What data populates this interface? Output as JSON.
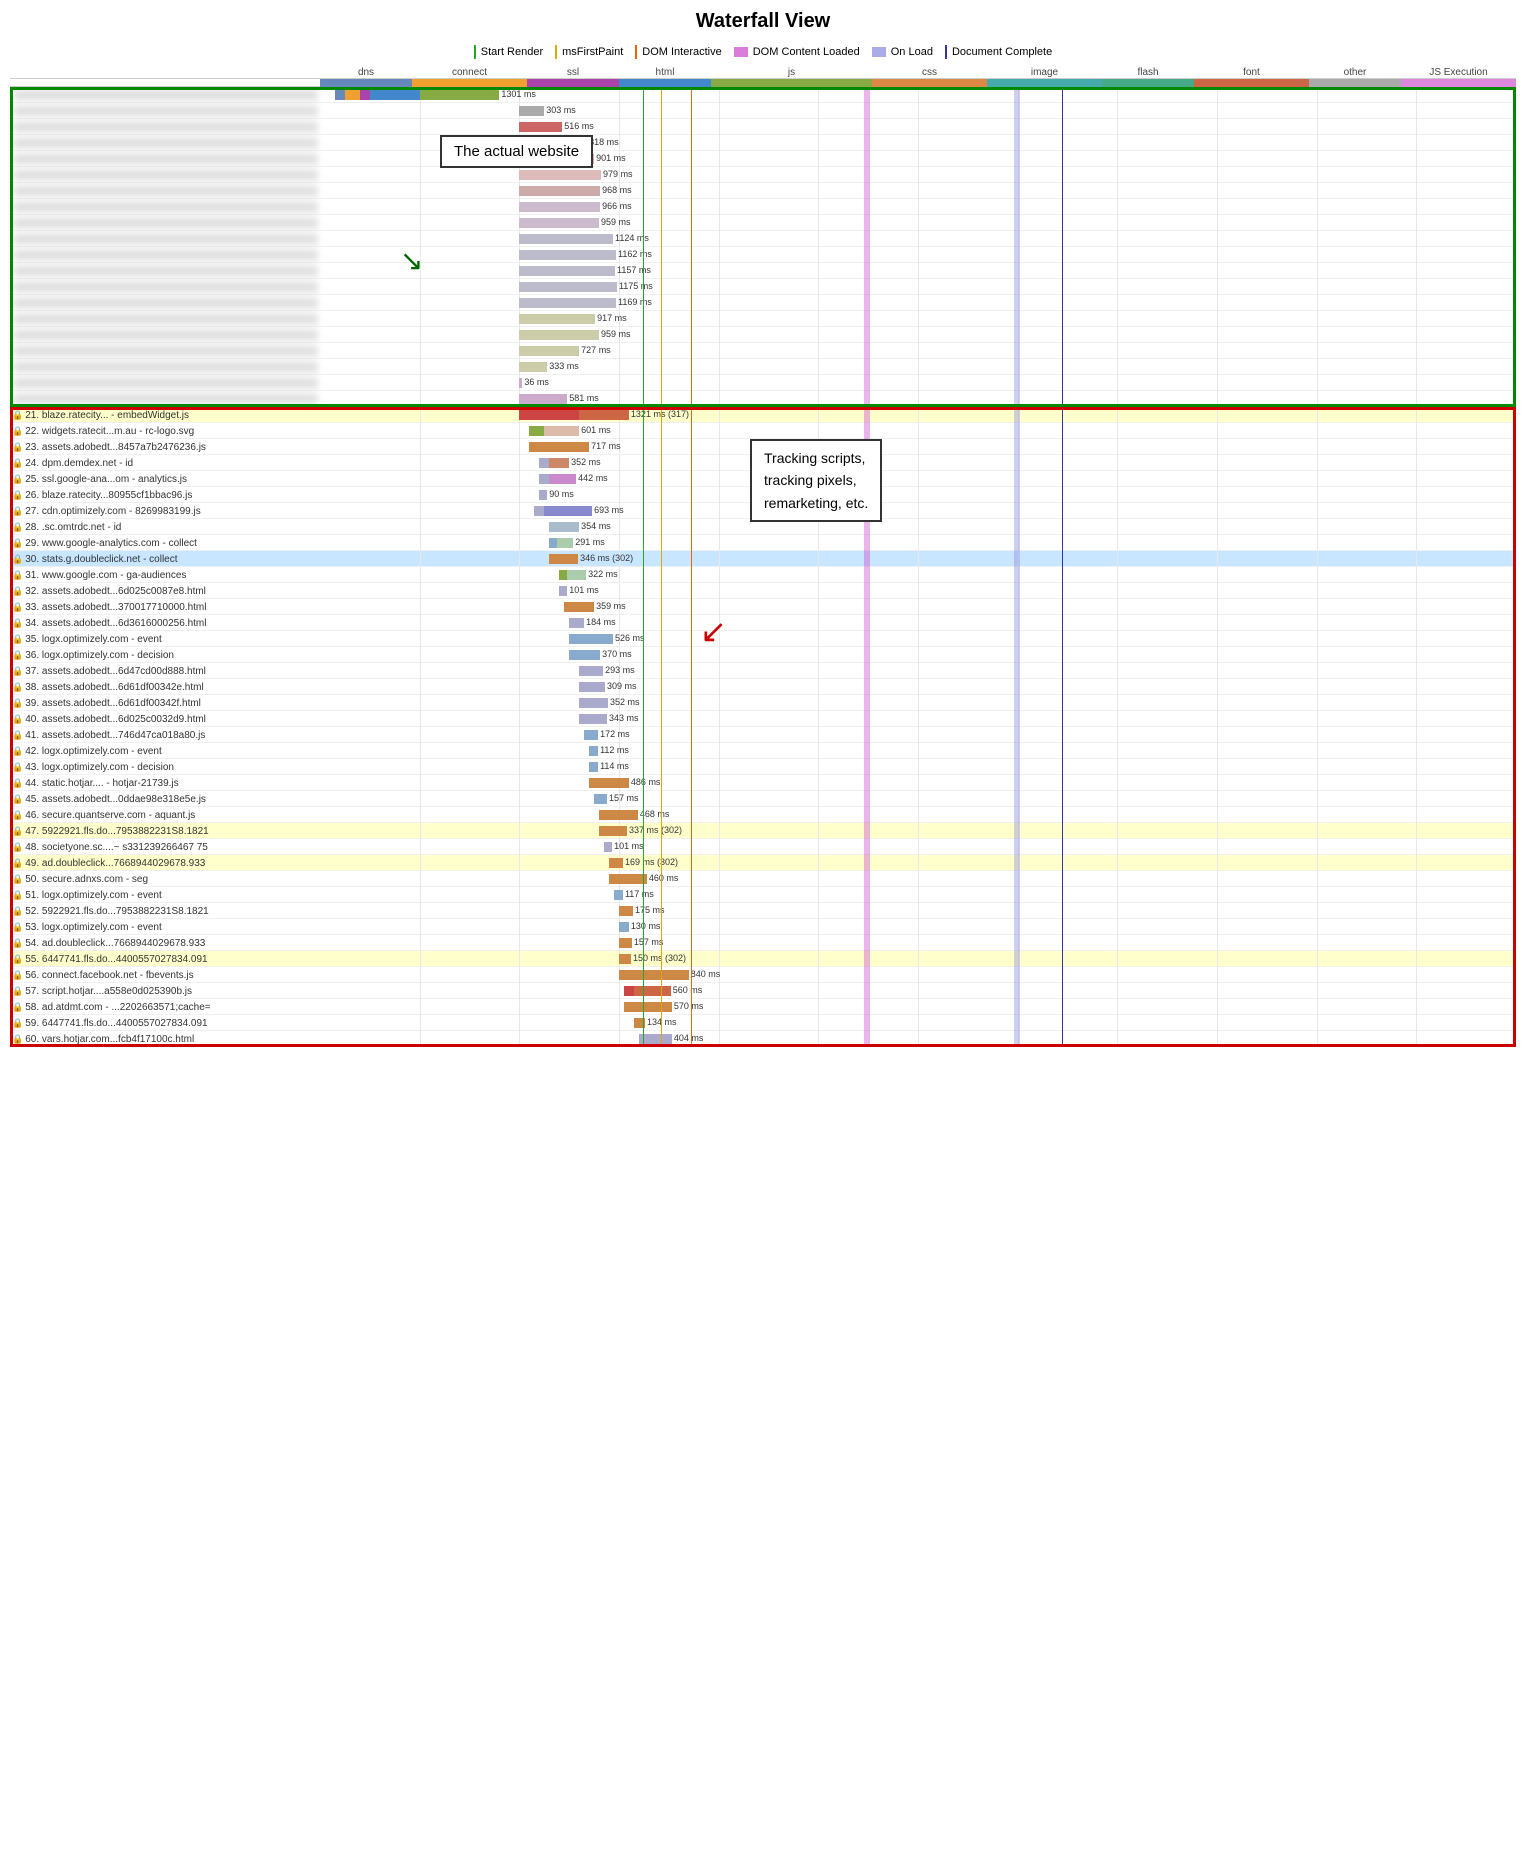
{
  "title": "Waterfall View",
  "legend": {
    "items": [
      {
        "label": "Start Render",
        "color": "#22aa22",
        "type": "line"
      },
      {
        "label": "msFirstPaint",
        "color": "#ddaa00",
        "type": "line"
      },
      {
        "label": "DOM Interactive",
        "color": "#ee6600",
        "type": "line"
      },
      {
        "label": "DOM Content Loaded",
        "color": "#cc44cc",
        "type": "bar"
      },
      {
        "label": "On Load",
        "color": "#8888dd",
        "type": "bar"
      },
      {
        "label": "Document Complete",
        "color": "#3333aa",
        "type": "line"
      }
    ]
  },
  "type_headers": [
    {
      "label": "dns",
      "color": "#6688bb",
      "width": 4
    },
    {
      "label": "connect",
      "color": "#f0a030",
      "width": 6
    },
    {
      "label": "ssl",
      "color": "#aa44aa",
      "width": 4
    },
    {
      "label": "html",
      "color": "#4488cc",
      "width": 4
    },
    {
      "label": "js",
      "color": "#88aa44",
      "width": 8
    },
    {
      "label": "css",
      "color": "#dd8844",
      "width": 6
    },
    {
      "label": "image",
      "color": "#44aaaa",
      "width": 6
    },
    {
      "label": "flash",
      "color": "#44aa88",
      "width": 5
    },
    {
      "label": "font",
      "color": "#cc6644",
      "width": 5
    },
    {
      "label": "other",
      "color": "#aaaaaa",
      "width": 4
    },
    {
      "label": "JS Execution",
      "color": "#dd88dd",
      "width": 5
    }
  ],
  "rows": [
    {
      "id": 1,
      "url": "(blurred)",
      "blurred": true,
      "start": 0,
      "dns": 0.5,
      "connect": 0.3,
      "ssl": 0.2,
      "ttfb": 0.8,
      "download": 0.3,
      "color": "#88aacc",
      "label": "1301 ms",
      "rowtype": "normal"
    },
    {
      "id": 2,
      "url": "(blurred)",
      "blurred": true,
      "start": 2.0,
      "ttfb": 0.3,
      "download": 0.1,
      "color": "#cccccc",
      "label": "303 ms",
      "rowtype": "normal"
    },
    {
      "id": 3,
      "url": "(blurred)",
      "blurred": true,
      "start": 2.0,
      "ttfb": 0.3,
      "download": 0.2,
      "color": "#cc6666",
      "label": "516 ms",
      "rowtype": "normal"
    },
    {
      "id": 4,
      "url": "(blurred)",
      "blurred": true,
      "start": 2.0,
      "ttfb": 0.5,
      "download": 0.3,
      "color": "#cc8888",
      "label": "818 ms",
      "rowtype": "normal"
    },
    {
      "id": 5,
      "url": "(blurred)",
      "blurred": true,
      "start": 2.0,
      "ttfb": 0.5,
      "download": 0.4,
      "color": "#ddaaaa",
      "label": "901 ms",
      "rowtype": "normal"
    },
    {
      "id": 6,
      "url": "(blurred)",
      "blurred": true,
      "start": 2.0,
      "color": "#ddbbbb",
      "label": "979 ms",
      "rowtype": "normal"
    },
    {
      "id": 7,
      "url": "(blurred)",
      "blurred": true,
      "start": 2.0,
      "color": "#ccaaaa",
      "label": "968 ms",
      "rowtype": "normal"
    },
    {
      "id": 8,
      "url": "(blurred)",
      "blurred": true,
      "start": 2.0,
      "color": "#ccbbcc",
      "label": "966 ms",
      "rowtype": "normal"
    },
    {
      "id": 9,
      "url": "(blurred)",
      "blurred": true,
      "start": 2.0,
      "color": "#ccbbcc",
      "label": "959 ms",
      "rowtype": "normal"
    },
    {
      "id": 10,
      "url": "(blurred)",
      "blurred": true,
      "start": 2.0,
      "color": "#bbbbcc",
      "label": "1124 ms",
      "rowtype": "normal"
    },
    {
      "id": 11,
      "url": "(blurred)",
      "blurred": true,
      "start": 2.0,
      "color": "#bbbbcc",
      "label": "1162 ms",
      "rowtype": "normal"
    },
    {
      "id": 12,
      "url": "(blurred)",
      "blurred": true,
      "start": 2.0,
      "color": "#bbbbcc",
      "label": "1157 ms",
      "rowtype": "normal"
    },
    {
      "id": 13,
      "url": "(blurred)",
      "blurred": true,
      "start": 2.0,
      "color": "#bbbbcc",
      "label": "1175 ms",
      "rowtype": "normal"
    },
    {
      "id": 14,
      "url": "(blurred)",
      "blurred": true,
      "start": 2.0,
      "color": "#bbbbcc",
      "label": "1169 ms",
      "rowtype": "normal"
    },
    {
      "id": 15,
      "url": "(blurred)",
      "blurred": true,
      "start": 2.0,
      "color": "#ccccaa",
      "label": "917 ms",
      "rowtype": "normal"
    },
    {
      "id": 16,
      "url": "(blurred)",
      "blurred": true,
      "start": 2.0,
      "color": "#ccccaa",
      "label": "959 ms",
      "rowtype": "normal"
    },
    {
      "id": 17,
      "url": "(blurred)",
      "blurred": true,
      "start": 2.0,
      "color": "#ccccaa",
      "label": "727 ms",
      "rowtype": "normal"
    },
    {
      "id": 18,
      "url": "(blurred)",
      "blurred": true,
      "start": 2.0,
      "color": "#ccccaa",
      "label": "333 ms",
      "rowtype": "normal"
    },
    {
      "id": 19,
      "url": "(blurred)",
      "blurred": true,
      "start": 2.0,
      "color": "#ccaacc",
      "label": "36 ms",
      "rowtype": "normal"
    },
    {
      "id": 20,
      "url": "(blurred)",
      "blurred": true,
      "start": 2.0,
      "color": "#ccaacc",
      "label": "581 ms",
      "rowtype": "normal"
    },
    {
      "id": 21,
      "url": "21. blaze.ratecity... - embedWidget.js",
      "blurred": false,
      "start": 2.0,
      "color": "#cc4444",
      "label": "1321 ms (317)",
      "rowtype": "yellow"
    },
    {
      "id": 22,
      "url": "22. widgets.ratecit...m.au - rc-logo.svg",
      "blurred": false,
      "start": 2.1,
      "color": "#88aa44",
      "label": "601 ms",
      "rowtype": "normal"
    },
    {
      "id": 23,
      "url": "23. assets.adobedt...8457a7b2476236.js",
      "blurred": false,
      "start": 2.1,
      "color": "#cc8844",
      "label": "717 ms",
      "rowtype": "normal"
    },
    {
      "id": 24,
      "url": "24. dpm.demdex.net - id",
      "blurred": false,
      "start": 2.2,
      "color": "#ccaaaa",
      "label": "352 ms",
      "rowtype": "normal"
    },
    {
      "id": 25,
      "url": "25. ssl.google-ana...om - analytics.js",
      "blurred": false,
      "start": 2.2,
      "color": "#ccaacc",
      "label": "442 ms",
      "rowtype": "normal"
    },
    {
      "id": 26,
      "url": "26. blaze.ratecity...80955cf1bbac96.js",
      "blurred": false,
      "start": 2.2,
      "color": "#aaaacc",
      "label": "90 ms",
      "rowtype": "normal"
    },
    {
      "id": 27,
      "url": "27. cdn.optimizely.com - 8269983199.js",
      "blurred": false,
      "start": 2.2,
      "color": "#8888cc",
      "label": "693 ms",
      "rowtype": "normal"
    },
    {
      "id": 28,
      "url": "28.         .sc.omtrdc.net - id",
      "blurred": false,
      "start": 2.3,
      "color": "#aabbcc",
      "label": "354 ms",
      "rowtype": "normal"
    },
    {
      "id": 29,
      "url": "29. www.google-analytics.com - collect",
      "blurred": false,
      "start": 2.3,
      "color": "#aaccaa",
      "label": "291 ms",
      "rowtype": "normal"
    },
    {
      "id": 30,
      "url": "30. stats.g.doubleclick.net - collect",
      "blurred": false,
      "start": 2.3,
      "color": "#cc8844",
      "label": "346 ms (302)",
      "rowtype": "highlight"
    },
    {
      "id": 31,
      "url": "31. www.google.com - ga-audiences",
      "blurred": false,
      "start": 2.4,
      "color": "#aaccaa",
      "label": "322 ms",
      "rowtype": "normal"
    },
    {
      "id": 32,
      "url": "32. assets.adobedt...6d025c0087e8.html",
      "blurred": false,
      "start": 2.4,
      "color": "#aaaacc",
      "label": "101 ms",
      "rowtype": "normal"
    },
    {
      "id": 33,
      "url": "33. assets.adobedt...370017710000.html",
      "blurred": false,
      "start": 2.5,
      "color": "#cc8844",
      "label": "359 ms",
      "rowtype": "normal"
    },
    {
      "id": 34,
      "url": "34. assets.adobedt...6d3616000256.html",
      "blurred": false,
      "start": 2.5,
      "color": "#aaaacc",
      "label": "184 ms",
      "rowtype": "normal"
    },
    {
      "id": 35,
      "url": "35. logx.optimizely.com - event",
      "blurred": false,
      "start": 2.5,
      "color": "#88aacc",
      "label": "526 ms",
      "rowtype": "normal"
    },
    {
      "id": 36,
      "url": "36. logx.optimizely.com - decision",
      "blurred": false,
      "start": 2.5,
      "color": "#88aacc",
      "label": "370 ms",
      "rowtype": "normal"
    },
    {
      "id": 37,
      "url": "37. assets.adobedt...6d47cd00d888.html",
      "blurred": false,
      "start": 2.6,
      "color": "#aaaacc",
      "label": "293 ms",
      "rowtype": "normal"
    },
    {
      "id": 38,
      "url": "38. assets.adobedt...6d61df00342e.html",
      "blurred": false,
      "start": 2.6,
      "color": "#aaaacc",
      "label": "309 ms",
      "rowtype": "normal"
    },
    {
      "id": 39,
      "url": "39. assets.adobedt...6d61df00342f.html",
      "blurred": false,
      "start": 2.6,
      "color": "#aaaacc",
      "label": "352 ms",
      "rowtype": "normal"
    },
    {
      "id": 40,
      "url": "40. assets.adobedt...6d025c0032d9.html",
      "blurred": false,
      "start": 2.6,
      "color": "#aaaacc",
      "label": "343 ms",
      "rowtype": "normal"
    },
    {
      "id": 41,
      "url": "41. assets.adobedt...746d47ca018a80.js",
      "blurred": false,
      "start": 2.7,
      "color": "#88aacc",
      "label": "172 ms",
      "rowtype": "normal"
    },
    {
      "id": 42,
      "url": "42. logx.optimizely.com - event",
      "blurred": false,
      "start": 2.7,
      "color": "#88aacc",
      "label": "112 ms",
      "rowtype": "normal"
    },
    {
      "id": 43,
      "url": "43. logx.optimizely.com - decision",
      "blurred": false,
      "start": 2.7,
      "color": "#88aacc",
      "label": "114 ms",
      "rowtype": "normal"
    },
    {
      "id": 44,
      "url": "44. static.hotjar.... - hotjar-21739.js",
      "blurred": false,
      "start": 2.7,
      "color": "#cc8844",
      "label": "486 ms",
      "rowtype": "normal"
    },
    {
      "id": 45,
      "url": "45. assets.adobedt...0ddae98e318e5e.js",
      "blurred": false,
      "start": 2.8,
      "color": "#88aacc",
      "label": "157 ms",
      "rowtype": "normal"
    },
    {
      "id": 46,
      "url": "46. secure.quantserve.com - aquant.js",
      "blurred": false,
      "start": 2.8,
      "color": "#cc8844",
      "label": "468 ms",
      "rowtype": "normal"
    },
    {
      "id": 47,
      "url": "47. 5922921.fls.do...7953882231S8.1821",
      "blurred": false,
      "start": 2.8,
      "color": "#cc8844",
      "label": "337 ms (302)",
      "rowtype": "yellow"
    },
    {
      "id": 48,
      "url": "48. societyone.sc....~ s331239266467 75",
      "blurred": false,
      "start": 2.9,
      "color": "#aaaacc",
      "label": "101 ms",
      "rowtype": "normal"
    },
    {
      "id": 49,
      "url": "49. ad.doubleclick...7668944029678.933",
      "blurred": false,
      "start": 2.9,
      "color": "#cc8844",
      "label": "169 ms (302)",
      "rowtype": "yellow"
    },
    {
      "id": 50,
      "url": "50. secure.adnxs.com - seg",
      "blurred": false,
      "start": 2.9,
      "color": "#cc8844",
      "label": "460 ms",
      "rowtype": "normal"
    },
    {
      "id": 51,
      "url": "51. logx.optimizely.com - event",
      "blurred": false,
      "start": 3.0,
      "color": "#88aacc",
      "label": "117 ms",
      "rowtype": "normal"
    },
    {
      "id": 52,
      "url": "52. 5922921.fls.do...7953882231S8.1821",
      "blurred": false,
      "start": 3.0,
      "color": "#cc8844",
      "label": "175 ms",
      "rowtype": "normal"
    },
    {
      "id": 53,
      "url": "53. logx.optimizely.com - event",
      "blurred": false,
      "start": 3.0,
      "color": "#88aacc",
      "label": "130 ms",
      "rowtype": "normal"
    },
    {
      "id": 54,
      "url": "54. ad.doubleclick...7668944029678.933",
      "blurred": false,
      "start": 3.0,
      "color": "#cc8844",
      "label": "157 ms",
      "rowtype": "normal"
    },
    {
      "id": 55,
      "url": "55. 6447741.fls.do...4400557027834.091",
      "blurred": false,
      "start": 3.0,
      "color": "#cc8844",
      "label": "150 ms (302)",
      "rowtype": "yellow"
    },
    {
      "id": 56,
      "url": "56. connect.facebook.net - fbevents.js",
      "blurred": false,
      "start": 3.1,
      "color": "#cc8844",
      "label": "840 ms",
      "rowtype": "normal"
    },
    {
      "id": 57,
      "url": "57. script.hotjar....a558e0d025390b.js",
      "blurred": false,
      "start": 3.1,
      "color": "#cc4444",
      "label": "560 ms",
      "rowtype": "normal"
    },
    {
      "id": 58,
      "url": "58. ad.atdmt.com - ...2202663571;cache=",
      "blurred": false,
      "start": 3.1,
      "color": "#cc8844",
      "label": "570 ms",
      "rowtype": "normal"
    },
    {
      "id": 59,
      "url": "59. 6447741.fls.do...4400557027834.091",
      "blurred": false,
      "start": 3.2,
      "color": "#cc8844",
      "label": "134 ms",
      "rowtype": "normal"
    },
    {
      "id": 60,
      "url": "60. vars.hotjar.com...fcb4f17100c.html",
      "blurred": false,
      "start": 3.2,
      "color": "#aaaacc",
      "label": "404 ms",
      "rowtype": "normal"
    }
  ],
  "annotations": {
    "actual_website": "The actual website",
    "tracking": "Tracking scripts,\ntracking pixels,\nremarketing, etc."
  },
  "markers": {
    "start_render": {
      "x_pct": 28,
      "color": "#22aa22"
    },
    "ms_first_paint": {
      "x_pct": 30,
      "color": "#ddaa00"
    },
    "dom_interactive": {
      "x_pct": 33,
      "color": "#ee6600"
    },
    "dom_content_loaded": {
      "x_pct": 46,
      "color": "#cc44cc"
    },
    "on_load": {
      "x_pct": 58,
      "color": "#8888dd"
    },
    "document_complete": {
      "x_pct": 62,
      "color": "#3333aa"
    }
  }
}
